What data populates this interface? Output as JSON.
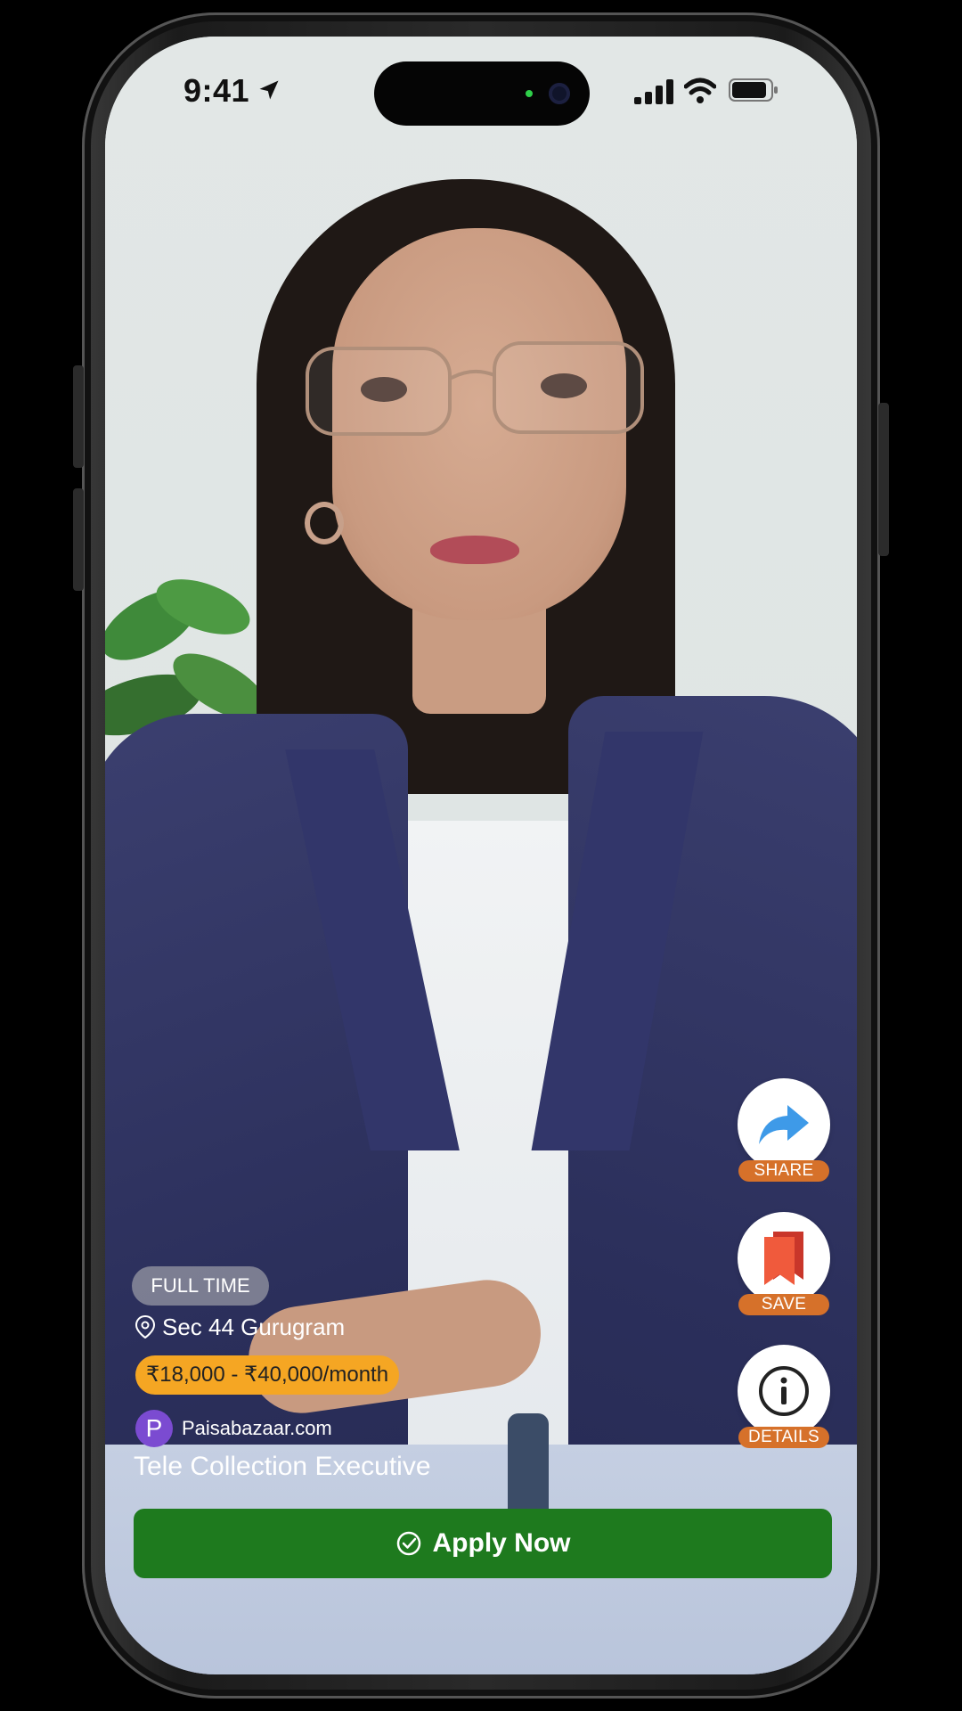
{
  "status_bar": {
    "time": "9:41"
  },
  "actions": {
    "share_label": "SHARE",
    "save_label": "SAVE",
    "details_label": "DETAILS"
  },
  "job": {
    "employment_type": "FULL TIME",
    "location": "Sec 44 Gurugram",
    "salary": "₹18,000 - ₹40,000/month",
    "company_initial": "P",
    "company_name": "Paisabazaar.com",
    "title": "Tele Collection Executive"
  },
  "apply": {
    "label": "Apply Now"
  },
  "colors": {
    "apply_button": "#1e7a1e",
    "salary_chip": "#f5a623",
    "action_label": "#d6712a",
    "company_logo": "#7b4bd1",
    "share_icon": "#3e9ae8",
    "save_icon": "#f05a3c"
  },
  "icons": [
    "location-arrow-icon",
    "signal-icon",
    "wifi-icon",
    "battery-icon",
    "share-icon",
    "bookmark-icon",
    "info-icon",
    "location-pin-icon",
    "check-circle-icon"
  ]
}
